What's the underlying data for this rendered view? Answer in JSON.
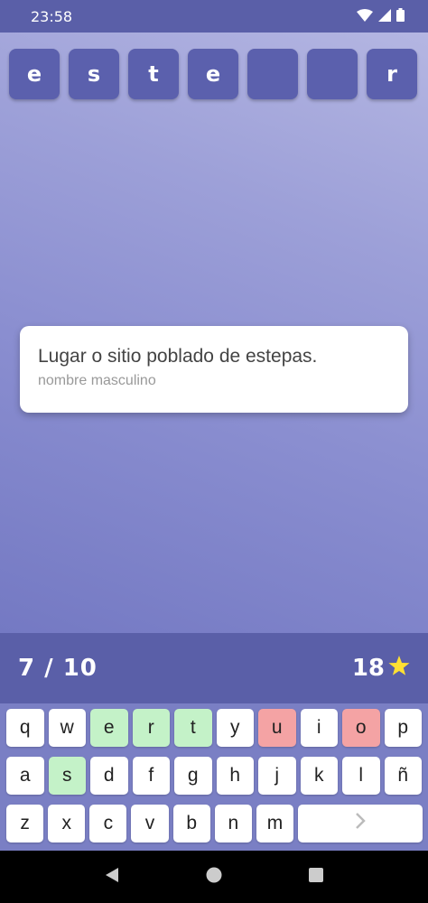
{
  "status": {
    "time": "23:58"
  },
  "word_tiles": [
    "e",
    "s",
    "t",
    "e",
    "",
    "",
    "r"
  ],
  "clue": {
    "text": "Lugar o sitio poblado de estepas.",
    "type": "nombre masculino"
  },
  "score": {
    "progress": "7 / 10",
    "stars": "18"
  },
  "keyboard": {
    "row1": [
      {
        "label": "q",
        "state": "normal"
      },
      {
        "label": "w",
        "state": "normal"
      },
      {
        "label": "e",
        "state": "correct"
      },
      {
        "label": "r",
        "state": "correct"
      },
      {
        "label": "t",
        "state": "correct"
      },
      {
        "label": "y",
        "state": "normal"
      },
      {
        "label": "u",
        "state": "wrong"
      },
      {
        "label": "i",
        "state": "normal"
      },
      {
        "label": "o",
        "state": "wrong"
      },
      {
        "label": "p",
        "state": "normal"
      }
    ],
    "row2": [
      {
        "label": "a",
        "state": "normal"
      },
      {
        "label": "s",
        "state": "correct"
      },
      {
        "label": "d",
        "state": "normal"
      },
      {
        "label": "f",
        "state": "normal"
      },
      {
        "label": "g",
        "state": "normal"
      },
      {
        "label": "h",
        "state": "normal"
      },
      {
        "label": "j",
        "state": "normal"
      },
      {
        "label": "k",
        "state": "normal"
      },
      {
        "label": "l",
        "state": "normal"
      },
      {
        "label": "ñ",
        "state": "normal"
      }
    ],
    "row3": [
      {
        "label": "z",
        "state": "normal"
      },
      {
        "label": "x",
        "state": "normal"
      },
      {
        "label": "c",
        "state": "normal"
      },
      {
        "label": "v",
        "state": "normal"
      },
      {
        "label": "b",
        "state": "normal"
      },
      {
        "label": "n",
        "state": "normal"
      },
      {
        "label": "m",
        "state": "normal"
      }
    ],
    "next_icon": "chevron-right-icon"
  },
  "colors": {
    "correct": "#c4f2c8",
    "wrong": "#f4a3a4",
    "tile": "#5b60ad",
    "bar": "#5a5fa8",
    "star": "#ffe033"
  },
  "icons": {
    "status": [
      "wifi-icon",
      "signal-icon",
      "battery-icon"
    ],
    "nav": [
      "back-icon",
      "home-icon",
      "recents-icon"
    ]
  }
}
